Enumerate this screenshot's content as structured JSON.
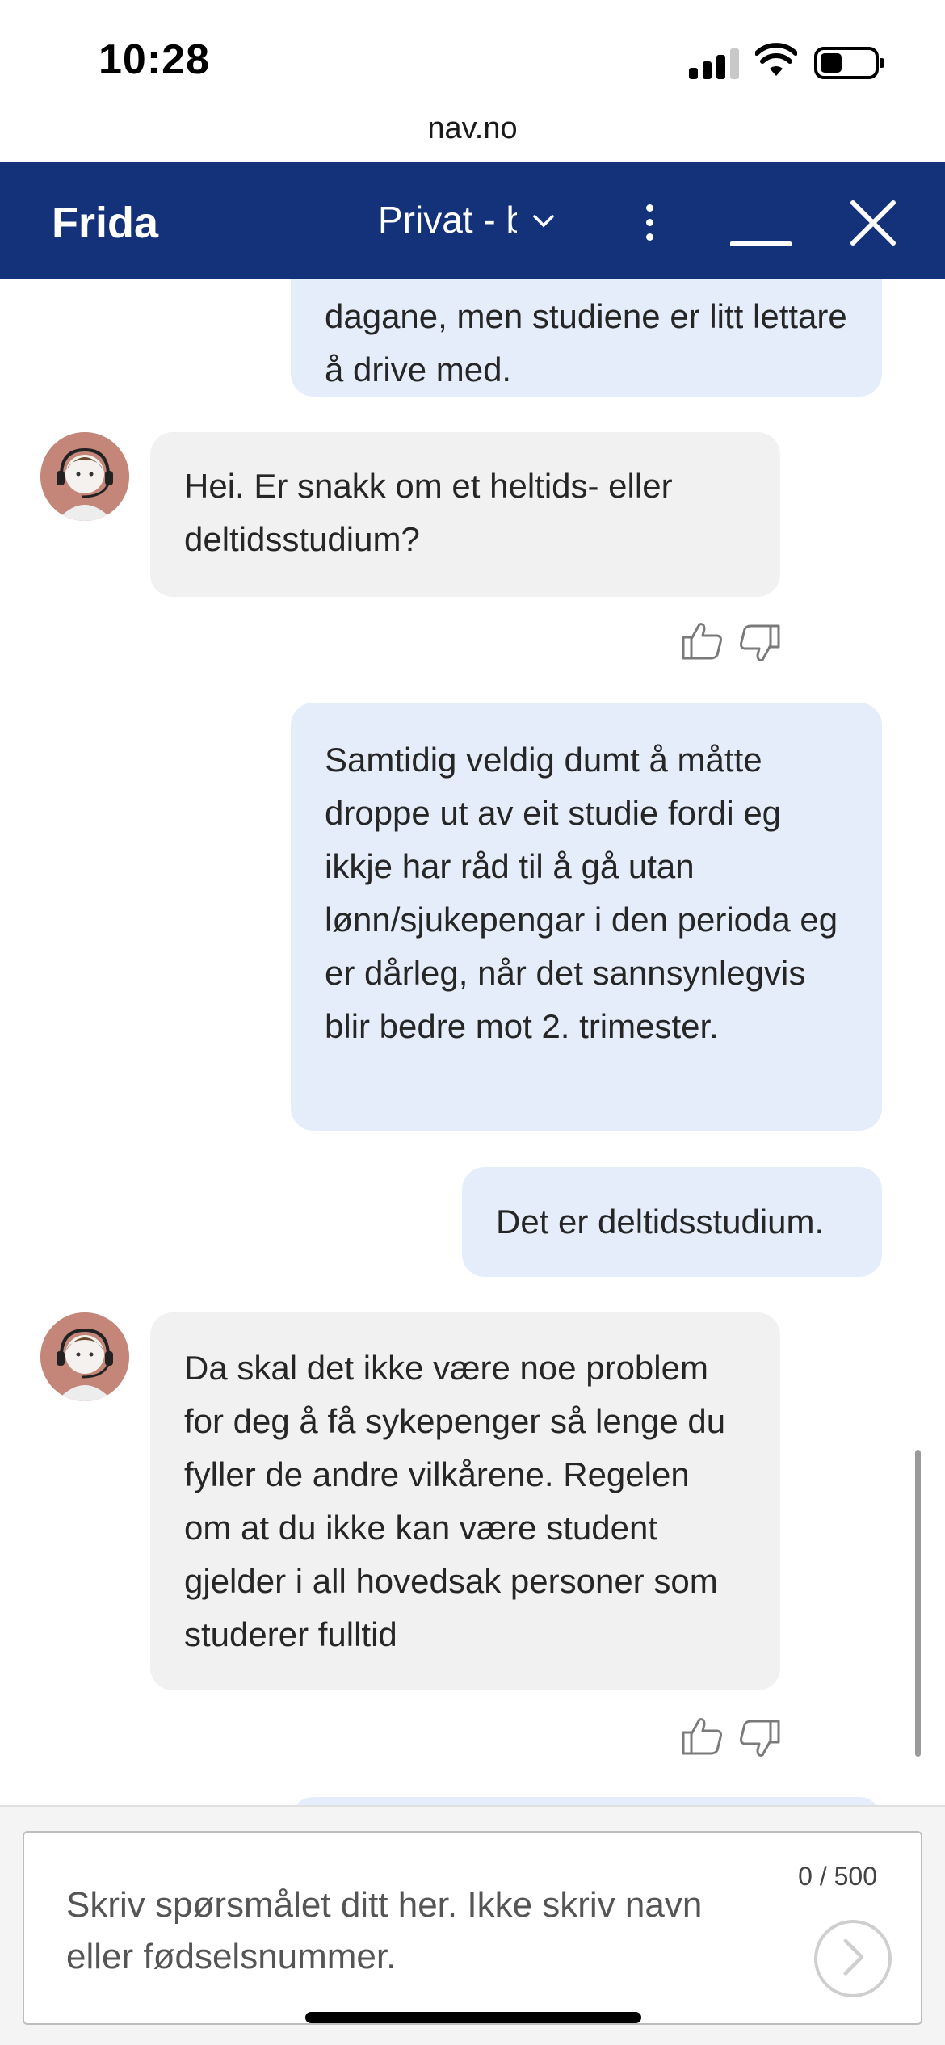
{
  "status_bar": {
    "time": "10:28"
  },
  "browser": {
    "url": "nav.no"
  },
  "header": {
    "title": "Frida",
    "topic": "Privat - b"
  },
  "messages": [
    {
      "from": "user",
      "text": "dagane, men studiene er litt lettare å drive med."
    },
    {
      "from": "bot",
      "text": "Hei. Er snakk om et heltids- eller deltidsstudium?"
    },
    {
      "from": "user",
      "text": "Samtidig veldig dumt å måtte droppe ut av eit studie fordi eg ikkje har råd til å gå utan lønn/sjukepengar i den perioda eg er dårleg, når det sannsynlegvis blir bedre mot 2. trimester."
    },
    {
      "from": "user",
      "text": "Det er deltidsstudium."
    },
    {
      "from": "bot",
      "text": "Da skal det ikke være noe problem for deg å få sykepenger så lenge du fyller de andre vilkårene. Regelen om at du ikke kan være student gjelder i all hovedsak personer som studerer fulltid"
    }
  ],
  "composer": {
    "placeholder": "Skriv spørsmålet ditt her. Ikke skriv navn eller fødselsnummer.",
    "counter": "0 / 500"
  },
  "colors": {
    "header": "#13327a",
    "user_bubble": "#e5edfb",
    "bot_bubble": "#f1f1f1"
  },
  "icons": [
    "signal-icon",
    "wifi-icon",
    "battery-icon",
    "chevron-down-icon",
    "more-vert-icon",
    "minimize-icon",
    "close-icon",
    "agent-avatar-icon",
    "thumbs-up-icon",
    "thumbs-down-icon",
    "send-arrow-icon"
  ]
}
